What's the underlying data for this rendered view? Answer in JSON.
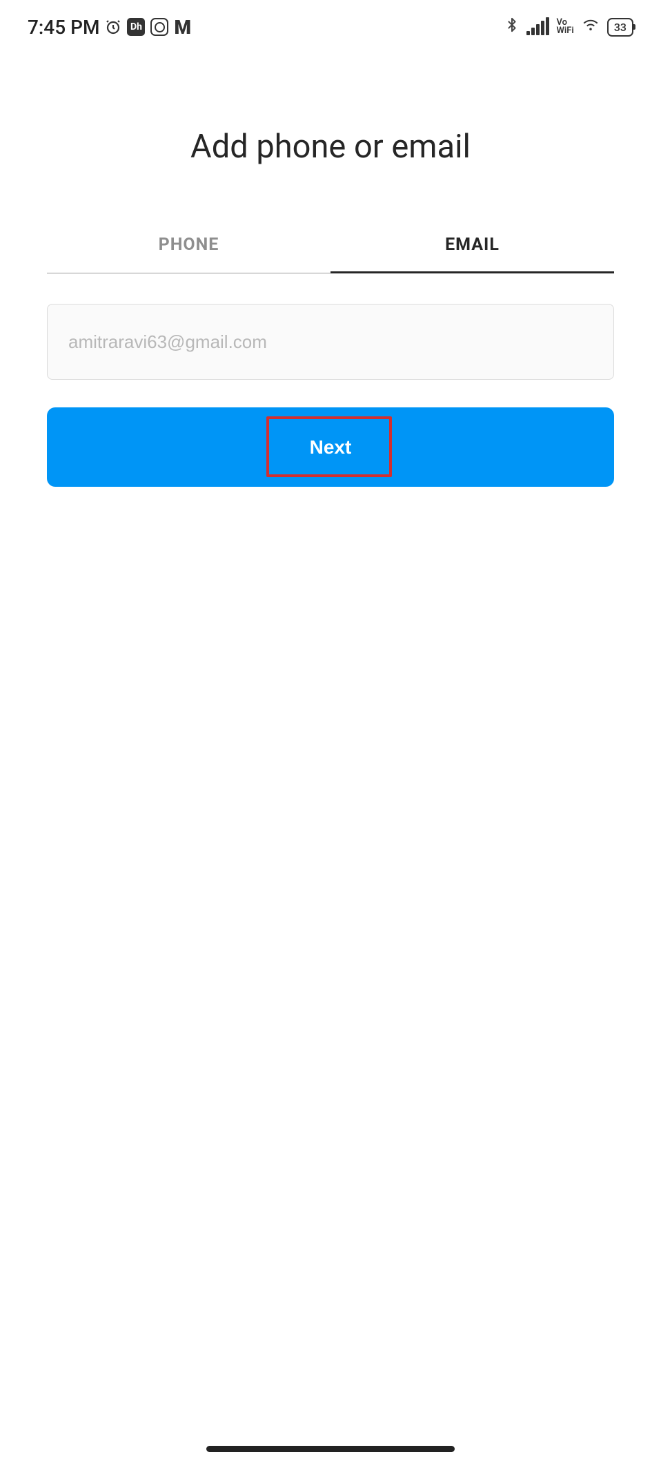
{
  "status_bar": {
    "time": "7:45 PM",
    "app_icon_text": "Dh",
    "m_icon": "M",
    "vo_label_top": "Vo",
    "vo_label_bottom": "WiFi",
    "battery": "33"
  },
  "header": {
    "title": "Add phone or email"
  },
  "tabs": {
    "phone": "PHONE",
    "email": "EMAIL"
  },
  "input": {
    "email_value": "amitraravi63@gmail.com"
  },
  "button": {
    "next": "Next"
  }
}
